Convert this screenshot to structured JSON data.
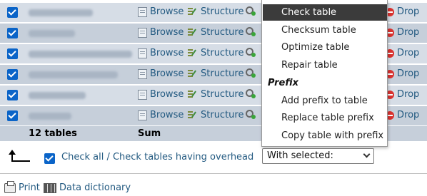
{
  "rows": [
    {
      "actions": [
        "Browse",
        "Structure",
        "Drop"
      ]
    },
    {
      "actions": [
        "Browse",
        "Structure",
        "Drop"
      ]
    },
    {
      "actions": [
        "Browse",
        "Structure",
        "Drop"
      ]
    },
    {
      "actions": [
        "Browse",
        "Structure",
        "Drop"
      ]
    },
    {
      "actions": [
        "Browse",
        "Structure",
        "Drop"
      ]
    },
    {
      "actions": [
        "Browse",
        "Structure",
        "Drop"
      ]
    }
  ],
  "footer": {
    "table_count": "12 tables",
    "sum": "Sum"
  },
  "menu": {
    "items": [
      "Check table",
      "Checksum table",
      "Optimize table",
      "Repair table"
    ],
    "group_label": "Prefix",
    "prefix_items": [
      "Add prefix to table",
      "Replace table prefix",
      "Copy table with prefix"
    ],
    "selected": "Check table"
  },
  "bottom": {
    "check_all": "Check all",
    "separator": " / ",
    "check_overhead": "Check tables having overhead",
    "with_selected": "With selected:",
    "print": "Print",
    "data_dictionary": "Data dictionary"
  },
  "colors": {
    "link": "#235a81",
    "row": "#d6dde6",
    "row_alt": "#c6cfda",
    "checkbox": "#0a64c8",
    "drop_icon": "#d9322f"
  }
}
